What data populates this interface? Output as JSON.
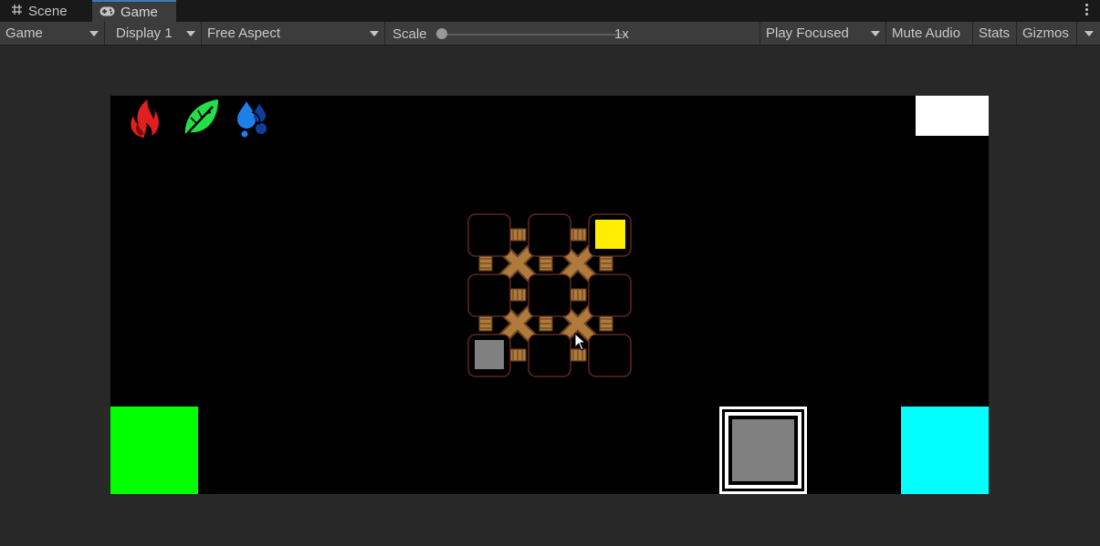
{
  "tabs": {
    "scene_label": "Scene",
    "game_label": "Game",
    "scene_icon": "grid-hash-icon",
    "game_icon": "gamepad-icon"
  },
  "toolbar": {
    "view_mode": "Game",
    "display": "Display 1",
    "aspect": "Free Aspect",
    "scale_label": "Scale",
    "scale_value": "1x",
    "play_mode": "Play Focused",
    "mute_audio": "Mute Audio",
    "stats": "Stats",
    "gizmos": "Gizmos"
  },
  "game": {
    "element_icons": [
      "fire-icon",
      "leaf-icon",
      "water-icon"
    ],
    "colors": {
      "fire": "#e02020",
      "leaf": "#22e04a",
      "water": "#1e7fe8",
      "yellow_tile": "#ffee00",
      "gray_tile": "#808080",
      "wood": "#b07a3c",
      "cell_outline": "#6b2f24"
    },
    "grid": {
      "rows": 3,
      "cols": 3,
      "yellow_cell": [
        0,
        2
      ],
      "gray_cell": [
        2,
        0
      ]
    }
  }
}
